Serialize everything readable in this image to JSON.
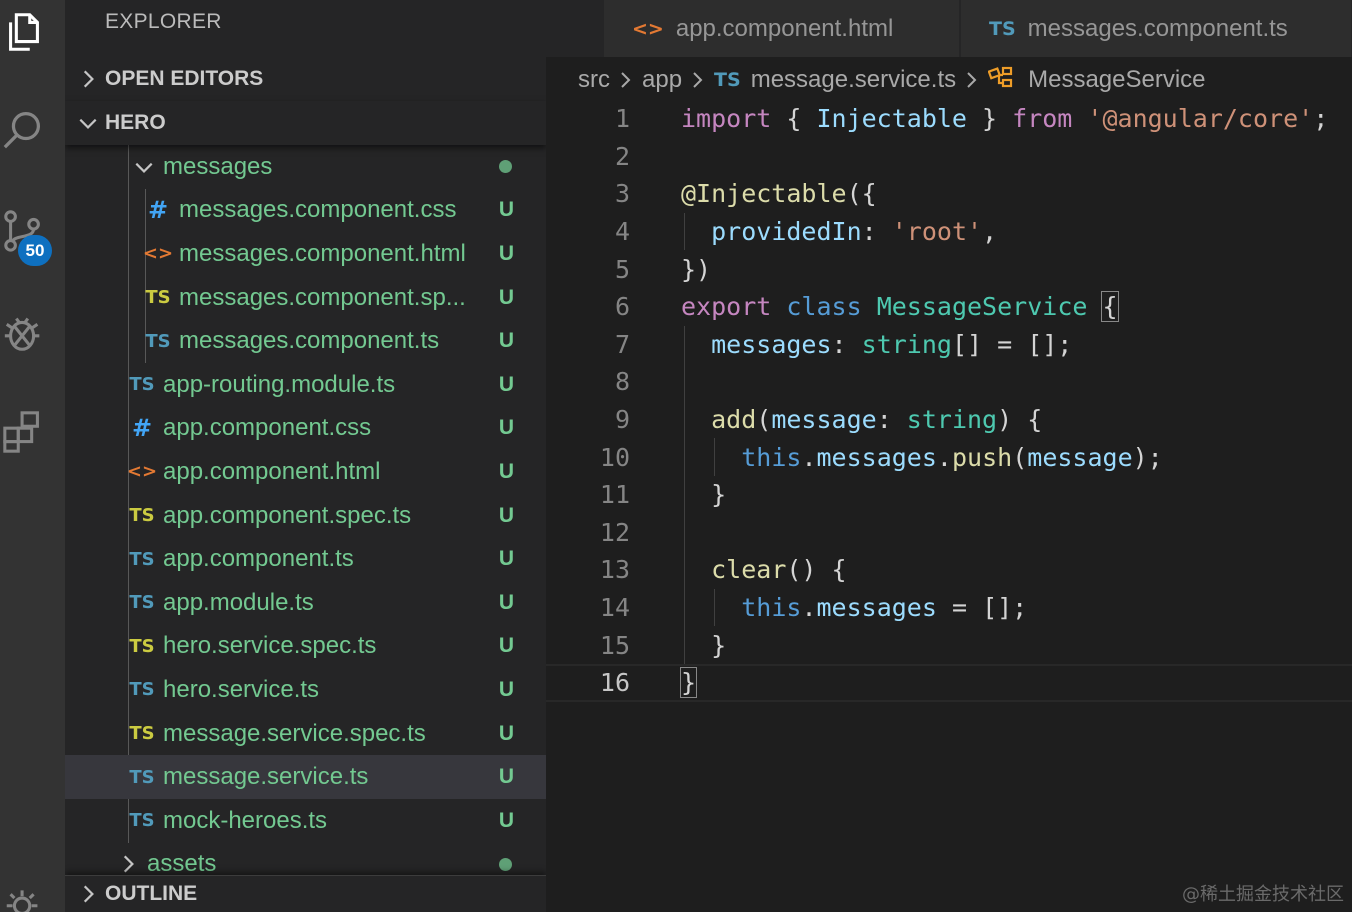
{
  "activity_bar": {
    "items": [
      {
        "icon": "files-icon"
      },
      {
        "icon": "search-icon"
      },
      {
        "icon": "source-control-icon",
        "badge": "50"
      },
      {
        "icon": "debug-icon"
      },
      {
        "icon": "extensions-icon"
      },
      {
        "icon": "settings-gear-icon"
      }
    ]
  },
  "sidebar": {
    "title": "EXPLORER",
    "open_editors": "OPEN EDITORS",
    "project": "HERO",
    "outline": "OUTLINE",
    "tree": [
      {
        "label": "messages",
        "kind": "folder",
        "status": "dot"
      },
      {
        "label": "messages.component.css",
        "kind": "css",
        "status": "U"
      },
      {
        "label": "messages.component.html",
        "kind": "html",
        "status": "U"
      },
      {
        "label": "messages.component.sp...",
        "kind": "spec",
        "status": "U"
      },
      {
        "label": "messages.component.ts",
        "kind": "ts",
        "status": "U"
      },
      {
        "label": "app-routing.module.ts",
        "kind": "ts",
        "status": "U"
      },
      {
        "label": "app.component.css",
        "kind": "css",
        "status": "U"
      },
      {
        "label": "app.component.html",
        "kind": "html",
        "status": "U"
      },
      {
        "label": "app.component.spec.ts",
        "kind": "spec",
        "status": "U"
      },
      {
        "label": "app.component.ts",
        "kind": "ts",
        "status": "U"
      },
      {
        "label": "app.module.ts",
        "kind": "ts",
        "status": "U"
      },
      {
        "label": "hero.service.spec.ts",
        "kind": "spec",
        "status": "U"
      },
      {
        "label": "hero.service.ts",
        "kind": "ts",
        "status": "U"
      },
      {
        "label": "message.service.spec.ts",
        "kind": "spec",
        "status": "U"
      },
      {
        "label": "message.service.ts",
        "kind": "ts",
        "status": "U",
        "selected": true
      },
      {
        "label": "mock-heroes.ts",
        "kind": "ts",
        "status": "U"
      },
      {
        "label": "assets",
        "kind": "folder-collapsed",
        "status": "dot"
      }
    ]
  },
  "icons": {
    "ts": "TS",
    "css": "#",
    "html": "<>"
  },
  "tabs": [
    {
      "label": "app.component.html",
      "icon": "<>"
    },
    {
      "label": "messages.component.ts",
      "icon": "TS"
    }
  ],
  "breadcrumb": {
    "parts": [
      "src",
      "app"
    ],
    "file": "message.service.ts",
    "file_icon": "TS",
    "symbol": "MessageService"
  },
  "code": {
    "line_numbers": [
      "1",
      "2",
      "3",
      "4",
      "5",
      "6",
      "7",
      "8",
      "9",
      "10",
      "11",
      "12",
      "13",
      "14",
      "15",
      "16"
    ],
    "lines": [
      [
        [
          "kw",
          "import"
        ],
        [
          "pu",
          " { "
        ],
        [
          "vr",
          "Injectable"
        ],
        [
          "pu",
          " } "
        ],
        [
          "kw",
          "from"
        ],
        [
          "pu",
          " "
        ],
        [
          "st",
          "'@angular/core'"
        ],
        [
          "pu",
          ";"
        ]
      ],
      [],
      [
        [
          "fn",
          "@Injectable"
        ],
        [
          "pu",
          "({"
        ]
      ],
      [
        [
          "pu",
          "  "
        ],
        [
          "vr",
          "providedIn"
        ],
        [
          "pu",
          ": "
        ],
        [
          "st",
          "'root'"
        ],
        [
          "pu",
          ","
        ]
      ],
      [
        [
          "pu",
          "})"
        ]
      ],
      [
        [
          "kw",
          "export"
        ],
        [
          "pu",
          " "
        ],
        [
          "kb",
          "class"
        ],
        [
          "pu",
          " "
        ],
        [
          "ty",
          "MessageService"
        ],
        [
          "pu",
          " "
        ],
        [
          "bm",
          "{"
        ]
      ],
      [
        [
          "pu",
          "  "
        ],
        [
          "vr",
          "messages"
        ],
        [
          "pu",
          ": "
        ],
        [
          "ty",
          "string"
        ],
        [
          "pu",
          "[] = [];"
        ]
      ],
      [],
      [
        [
          "pu",
          "  "
        ],
        [
          "fn",
          "add"
        ],
        [
          "pu",
          "("
        ],
        [
          "vr",
          "message"
        ],
        [
          "pu",
          ": "
        ],
        [
          "ty",
          "string"
        ],
        [
          "pu",
          ") {"
        ]
      ],
      [
        [
          "pu",
          "    "
        ],
        [
          "kb",
          "this"
        ],
        [
          "pu",
          "."
        ],
        [
          "vr",
          "messages"
        ],
        [
          "pu",
          "."
        ],
        [
          "fn",
          "push"
        ],
        [
          "pu",
          "("
        ],
        [
          "vr",
          "message"
        ],
        [
          "pu",
          ");"
        ]
      ],
      [
        [
          "pu",
          "  }"
        ]
      ],
      [],
      [
        [
          "pu",
          "  "
        ],
        [
          "fn",
          "clear"
        ],
        [
          "pu",
          "() {"
        ]
      ],
      [
        [
          "pu",
          "    "
        ],
        [
          "kb",
          "this"
        ],
        [
          "pu",
          "."
        ],
        [
          "vr",
          "messages"
        ],
        [
          "pu",
          " = [];"
        ]
      ],
      [
        [
          "pu",
          "  }"
        ]
      ],
      [
        [
          "bm",
          "}"
        ]
      ]
    ],
    "current_line": "16"
  },
  "watermark": "@稀土掘金技术社区",
  "colors": {
    "git_untracked": "#73c991",
    "ts_icon": "#519aba",
    "spec_icon": "#cbcb41",
    "html_icon": "#e37933",
    "css_icon": "#42a5f5",
    "badge": "#0e70c0"
  }
}
